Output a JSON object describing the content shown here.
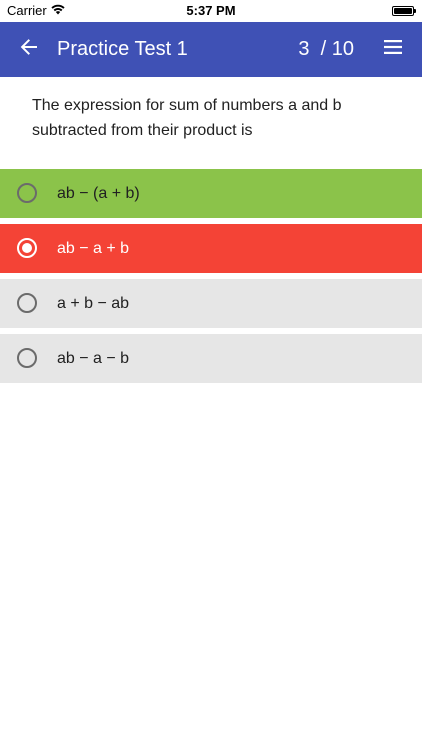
{
  "status_bar": {
    "carrier": "Carrier",
    "time": "5:37 PM"
  },
  "app_bar": {
    "title": "Practice Test 1",
    "progress": "3  / 10"
  },
  "question": {
    "text": "The expression for sum of numbers a and b subtracted from their product is"
  },
  "options": [
    {
      "label": "ab − (a + b)",
      "state": "correct",
      "color": "#8bc34a"
    },
    {
      "label": "ab − a + b",
      "state": "selected-wrong",
      "color": "#f44336"
    },
    {
      "label": "a + b − ab",
      "state": "unanswered",
      "color": "#e6e6e6"
    },
    {
      "label": "ab − a − b",
      "state": "unanswered",
      "color": "#e6e6e6"
    }
  ],
  "colors": {
    "app_bar": "#3f51b5",
    "correct": "#8bc34a",
    "wrong": "#f44336",
    "neutral": "#e6e6e6"
  }
}
